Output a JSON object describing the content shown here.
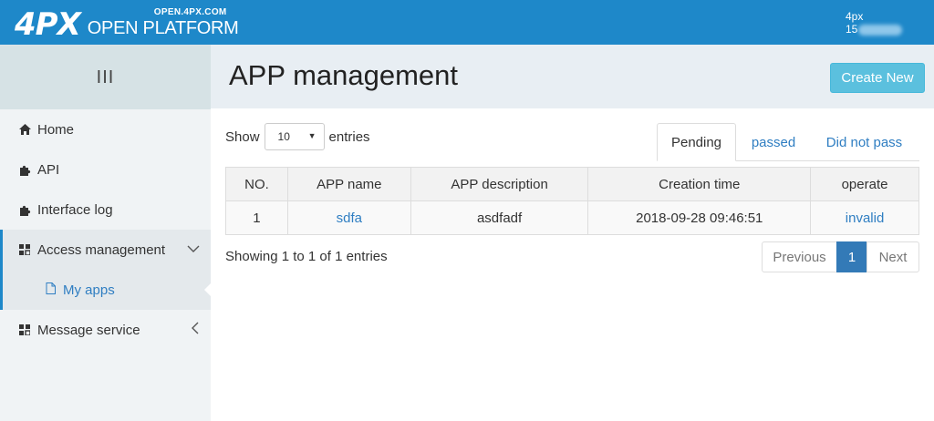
{
  "brand": {
    "logo_mark": "4PX",
    "domain": "OPEN.4PX.COM",
    "platform": "OPEN PLATFORM"
  },
  "user": {
    "name": "4px",
    "account": "15"
  },
  "sidebar": {
    "toggle_icon": "III",
    "items": [
      {
        "label": "Home",
        "icon": "home-icon"
      },
      {
        "label": "API",
        "icon": "puzzle-icon"
      },
      {
        "label": "Interface log",
        "icon": "puzzle-icon"
      },
      {
        "label": "Access management",
        "icon": "grid-icon",
        "expanded": true
      },
      {
        "label": "My apps",
        "icon": "file-icon",
        "sub": true
      },
      {
        "label": "Message service",
        "icon": "grid-icon",
        "expanded": false
      }
    ]
  },
  "header": {
    "title": "APP management",
    "create_label": "Create New"
  },
  "controls": {
    "show_label": "Show",
    "page_size": "10",
    "entries_label": "entries"
  },
  "tabs": [
    {
      "label": "Pending",
      "active": true
    },
    {
      "label": "passed",
      "active": false
    },
    {
      "label": "Did not pass",
      "active": false
    }
  ],
  "table": {
    "columns": [
      "NO.",
      "APP name",
      "APP description",
      "Creation time",
      "operate"
    ],
    "rows": [
      [
        "1",
        "sdfa",
        "asdfadf",
        "2018-09-28 09:46:51",
        "invalid"
      ]
    ]
  },
  "footer": {
    "info": "Showing 1 to 1 of 1 entries",
    "prev": "Previous",
    "page": "1",
    "next": "Next"
  },
  "colors": {
    "topbar": "#1e88c9",
    "link": "#2f7ec2",
    "create_button": "#5bc0de",
    "pager_active": "#337ab7"
  }
}
